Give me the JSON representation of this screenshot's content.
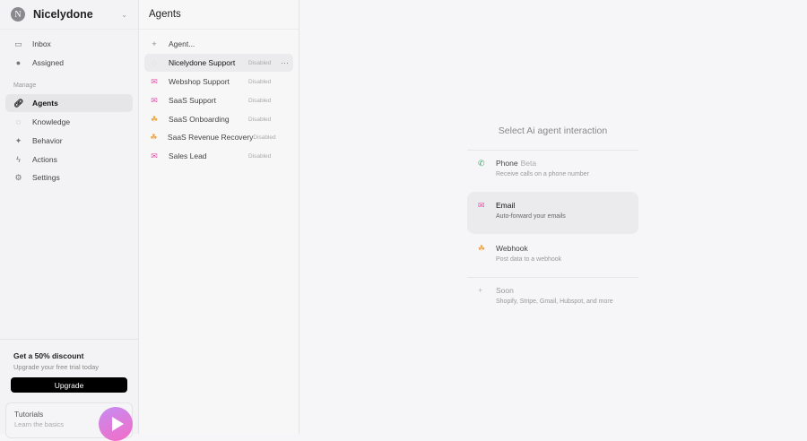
{
  "workspace": {
    "initial": "N",
    "name": "Nicelydone"
  },
  "sidebar": {
    "top": [
      {
        "label": "Inbox",
        "icon": "inbox-icon"
      },
      {
        "label": "Assigned",
        "icon": "assigned-icon"
      }
    ],
    "section": "Manage",
    "items": [
      {
        "label": "Agents",
        "icon": "link-icon"
      },
      {
        "label": "Knowledge",
        "icon": "knowledge-icon"
      },
      {
        "label": "Behavior",
        "icon": "sparkle-icon"
      },
      {
        "label": "Actions",
        "icon": "bolt-icon"
      },
      {
        "label": "Settings",
        "icon": "gear-icon"
      }
    ],
    "promo": {
      "title": "Get a 50% discount",
      "subtitle": "Upgrade your free trial today",
      "button": "Upgrade"
    },
    "tutorials": {
      "title": "Tutorials",
      "subtitle": "Learn the basics"
    }
  },
  "agents": {
    "title": "Agents",
    "add": "Agent...",
    "list": [
      {
        "name": "Nicelydone Support",
        "status": "Disabled",
        "type": "none"
      },
      {
        "name": "Webshop Support",
        "status": "Disabled",
        "type": "email"
      },
      {
        "name": "SaaS Support",
        "status": "Disabled",
        "type": "email"
      },
      {
        "name": "SaaS Onboarding",
        "status": "Disabled",
        "type": "webhook"
      },
      {
        "name": "SaaS Revenue Recovery",
        "status": "Disabled",
        "type": "webhook"
      },
      {
        "name": "Sales Lead",
        "status": "Disabled",
        "type": "email"
      }
    ],
    "more": "···"
  },
  "interaction": {
    "title": "Select Ai agent interaction",
    "options": [
      {
        "title": "Phone",
        "badge": "Beta",
        "subtitle": "Receive calls on a phone number"
      },
      {
        "title": "Email",
        "subtitle": "Auto-forward your emails"
      },
      {
        "title": "Webhook",
        "subtitle": "Post data to a webhook"
      },
      {
        "title": "Soon",
        "subtitle": "Shopify, Stripe, Gmail, Hubspot, and more"
      }
    ]
  },
  "colors": {
    "email": "#e84fa8",
    "webhook": "#f0a23b",
    "phone": "#2fae5f"
  }
}
